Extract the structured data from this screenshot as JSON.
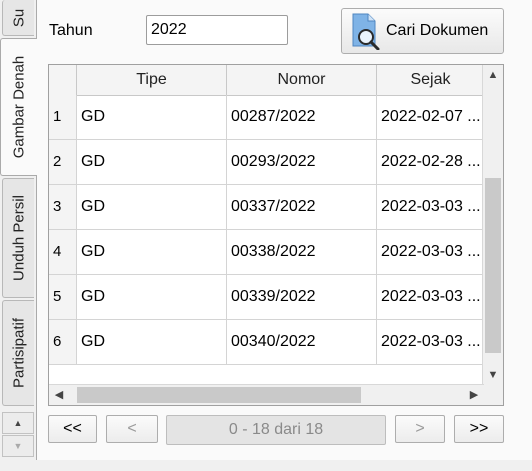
{
  "tabs": [
    {
      "label": "Su"
    },
    {
      "label": "Gambar Denah"
    },
    {
      "label": "Unduh Persil"
    },
    {
      "label": "Partisipatif"
    }
  ],
  "filter": {
    "year_label": "Tahun",
    "year_value": "2022"
  },
  "search_button": {
    "label": "Cari Dokumen",
    "icon": "document-search-icon"
  },
  "table": {
    "columns": [
      "Tipe",
      "Nomor",
      "Sejak"
    ],
    "rows": [
      {
        "no": "1",
        "tipe": "GD",
        "nomor": "00287/2022",
        "sejak": "2022-02-07 ..."
      },
      {
        "no": "2",
        "tipe": "GD",
        "nomor": "00293/2022",
        "sejak": "2022-02-28 ..."
      },
      {
        "no": "3",
        "tipe": "GD",
        "nomor": "00337/2022",
        "sejak": "2022-03-03 ..."
      },
      {
        "no": "4",
        "tipe": "GD",
        "nomor": "00338/2022",
        "sejak": "2022-03-03 ..."
      },
      {
        "no": "5",
        "tipe": "GD",
        "nomor": "00339/2022",
        "sejak": "2022-03-03 ..."
      },
      {
        "no": "6",
        "tipe": "GD",
        "nomor": "00340/2022",
        "sejak": "2022-03-03 ..."
      }
    ]
  },
  "pager": {
    "first": "<<",
    "prev": "<",
    "info": "0 - 18 dari 18",
    "next": ">",
    "last": ">>"
  }
}
